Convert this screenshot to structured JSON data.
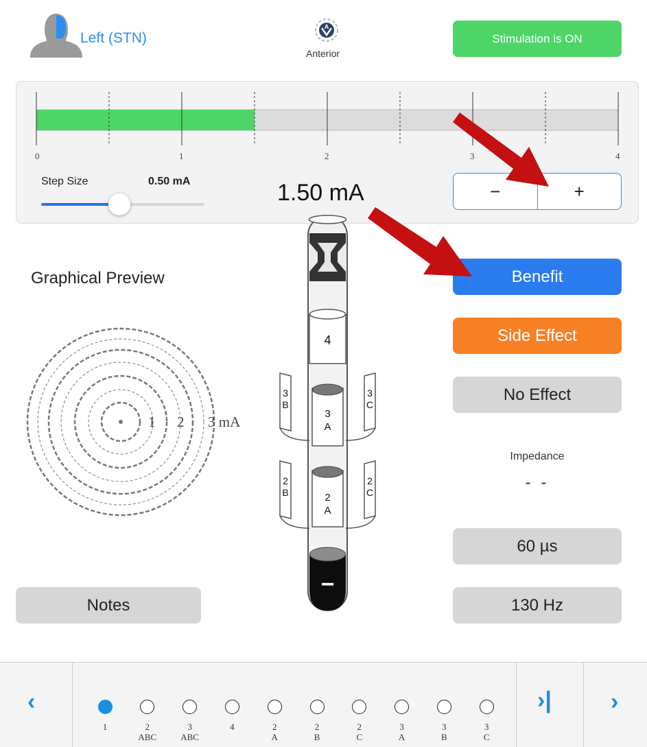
{
  "header": {
    "hemisphere_label": "Left (STN)",
    "orientation_label": "Anterior",
    "stimulation_status": "Stimulation is ON",
    "stimulation_color": "#4dd667"
  },
  "amplitude": {
    "scale_ticks": [
      "0",
      "1",
      "2",
      "3",
      "4"
    ],
    "scale_min": 0,
    "scale_max": 4,
    "current_value": 1.5,
    "display": "1.50 mA",
    "step_size_label": "Step Size",
    "step_size_value": "0.50 mA",
    "step_slider_fraction": 0.48,
    "decrement_label": "−",
    "increment_label": "+"
  },
  "preview": {
    "title": "Graphical Preview",
    "ring_labels": [
      "1",
      "2",
      "3 mA"
    ]
  },
  "lead": {
    "contact_4": "4",
    "contact_3a_top": "3",
    "contact_3a_bot": "A",
    "contact_3b_top": "3",
    "contact_3b_bot": "B",
    "contact_3c_top": "3",
    "contact_3c_bot": "C",
    "contact_2a_top": "2",
    "contact_2a_bot": "A",
    "contact_2b_top": "2",
    "contact_2b_bot": "B",
    "contact_2c_top": "2",
    "contact_2c_bot": "C",
    "cathode_symbol": "−"
  },
  "actions": {
    "benefit": "Benefit",
    "side_effect": "Side Effect",
    "no_effect": "No Effect",
    "notes": "Notes",
    "benefit_color": "#2a7cef",
    "side_effect_color": "#f78024"
  },
  "settings": {
    "impedance_label": "Impedance",
    "impedance_value": "- -",
    "pulse_width": "60 µs",
    "frequency": "130 Hz"
  },
  "bottom_nav": {
    "contacts": [
      {
        "top": "1",
        "bottom": "",
        "active": true
      },
      {
        "top": "2",
        "bottom": "ABC",
        "active": false
      },
      {
        "top": "3",
        "bottom": "ABC",
        "active": false
      },
      {
        "top": "4",
        "bottom": "",
        "active": false
      },
      {
        "top": "2",
        "bottom": "A",
        "active": false
      },
      {
        "top": "2",
        "bottom": "B",
        "active": false
      },
      {
        "top": "2",
        "bottom": "C",
        "active": false
      },
      {
        "top": "3",
        "bottom": "A",
        "active": false
      },
      {
        "top": "3",
        "bottom": "B",
        "active": false
      },
      {
        "top": "3",
        "bottom": "C",
        "active": false
      }
    ],
    "prev_icon": "chevron-left-icon",
    "skip_icon": "skip-to-end-icon",
    "next_icon": "chevron-right-icon"
  }
}
